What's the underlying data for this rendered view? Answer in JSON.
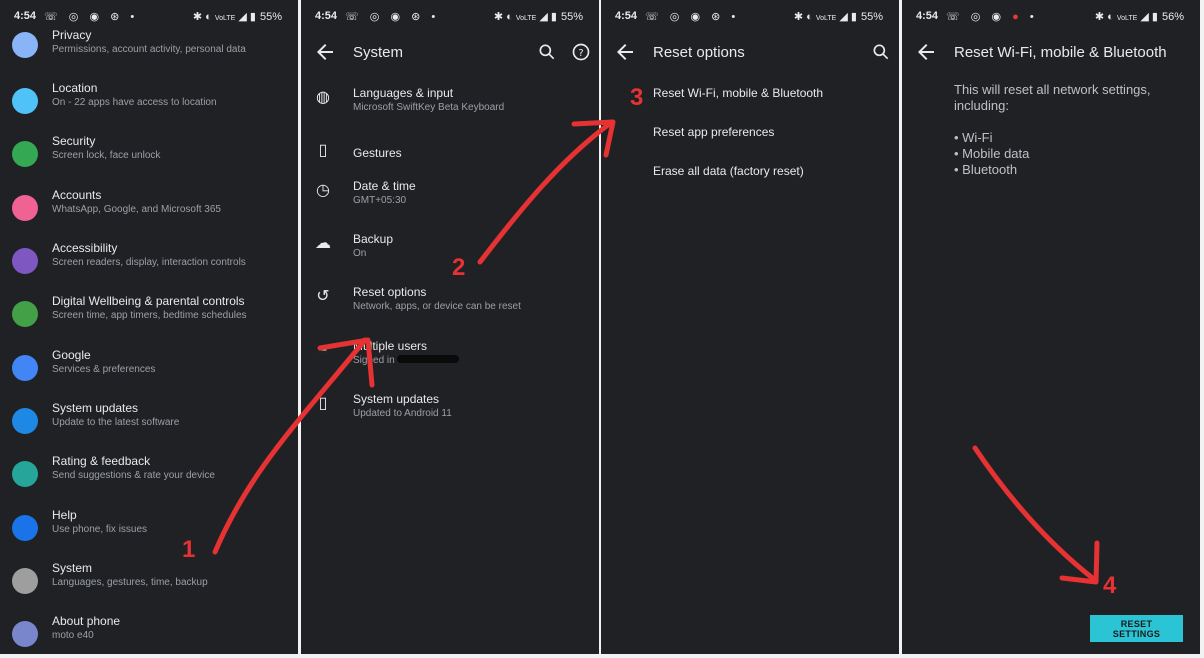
{
  "status": [
    {
      "time": "4:54",
      "battery": "55%",
      "signal": "VoLTE"
    },
    {
      "time": "4:54",
      "battery": "55%",
      "signal": "VoLTE"
    },
    {
      "time": "4:54",
      "battery": "55%",
      "signal": "VoLTE"
    },
    {
      "time": "4:54",
      "battery": "56%",
      "signal": "VoLTE"
    }
  ],
  "settings": {
    "items": [
      {
        "title": "Privacy",
        "subtitle": "Permissions, account activity, personal data",
        "color": "#8ab4f8",
        "icon": "privacy-icon"
      },
      {
        "title": "Location",
        "subtitle": "On - 22 apps have access to location",
        "color": "#4fc3f7",
        "icon": "location-icon"
      },
      {
        "title": "Security",
        "subtitle": "Screen lock, face unlock",
        "color": "#34a853",
        "icon": "lock-icon"
      },
      {
        "title": "Accounts",
        "subtitle": "WhatsApp, Google, and Microsoft 365",
        "color": "#f06292",
        "icon": "account-icon"
      },
      {
        "title": "Accessibility",
        "subtitle": "Screen readers, display, interaction controls",
        "color": "#7e57c2",
        "icon": "accessibility-icon"
      },
      {
        "title": "Digital Wellbeing & parental controls",
        "subtitle": "Screen time, app timers, bedtime schedules",
        "color": "#43a047",
        "icon": "wellbeing-icon"
      },
      {
        "title": "Google",
        "subtitle": "Services & preferences",
        "color": "#4285f4",
        "icon": "google-icon"
      },
      {
        "title": "System updates",
        "subtitle": "Update to the latest software",
        "color": "#1e88e5",
        "icon": "phone-update-icon"
      },
      {
        "title": "Rating & feedback",
        "subtitle": "Send suggestions & rate your device",
        "color": "#26a69a",
        "icon": "feedback-icon"
      },
      {
        "title": "Help",
        "subtitle": "Use phone, fix issues",
        "color": "#1a73e8",
        "icon": "help-icon"
      },
      {
        "title": "System",
        "subtitle": "Languages, gestures, time, backup",
        "color": "#9e9e9e",
        "icon": "system-info-icon"
      },
      {
        "title": "About phone",
        "subtitle": "moto e40",
        "color": "#7986cb",
        "icon": "phone-icon"
      }
    ]
  },
  "system": {
    "title": "System",
    "items": [
      {
        "title": "Languages & input",
        "subtitle": "Microsoft SwiftKey Beta Keyboard",
        "icon": "globe-icon"
      },
      {
        "title": "Gestures",
        "subtitle": "",
        "icon": "gesture-phone-icon"
      },
      {
        "title": "Date & time",
        "subtitle": "GMT+05:30",
        "icon": "clock-icon"
      },
      {
        "title": "Backup",
        "subtitle": "On",
        "icon": "cloud-upload-icon"
      },
      {
        "title": "Reset options",
        "subtitle": "Network, apps, or device can be reset",
        "icon": "history-icon"
      },
      {
        "title": "Multiple users",
        "subtitle": "Signed in",
        "icon": "person-icon"
      },
      {
        "title": "System updates",
        "subtitle": "Updated to Android 11",
        "icon": "system-update-icon"
      }
    ]
  },
  "reset_options": {
    "title": "Reset options",
    "items": [
      "Reset Wi-Fi, mobile & Bluetooth",
      "Reset app preferences",
      "Erase all data (factory reset)"
    ]
  },
  "reset_network": {
    "title": "Reset Wi-Fi, mobile & Bluetooth",
    "description": "This will reset all network settings, including:",
    "bullets": [
      "• Wi-Fi",
      "• Mobile data",
      "• Bluetooth"
    ],
    "button": "RESET SETTINGS"
  },
  "annotations": {
    "step1": "1",
    "step2": "2",
    "step3": "3",
    "step4": "4",
    "color": "#e63232"
  }
}
